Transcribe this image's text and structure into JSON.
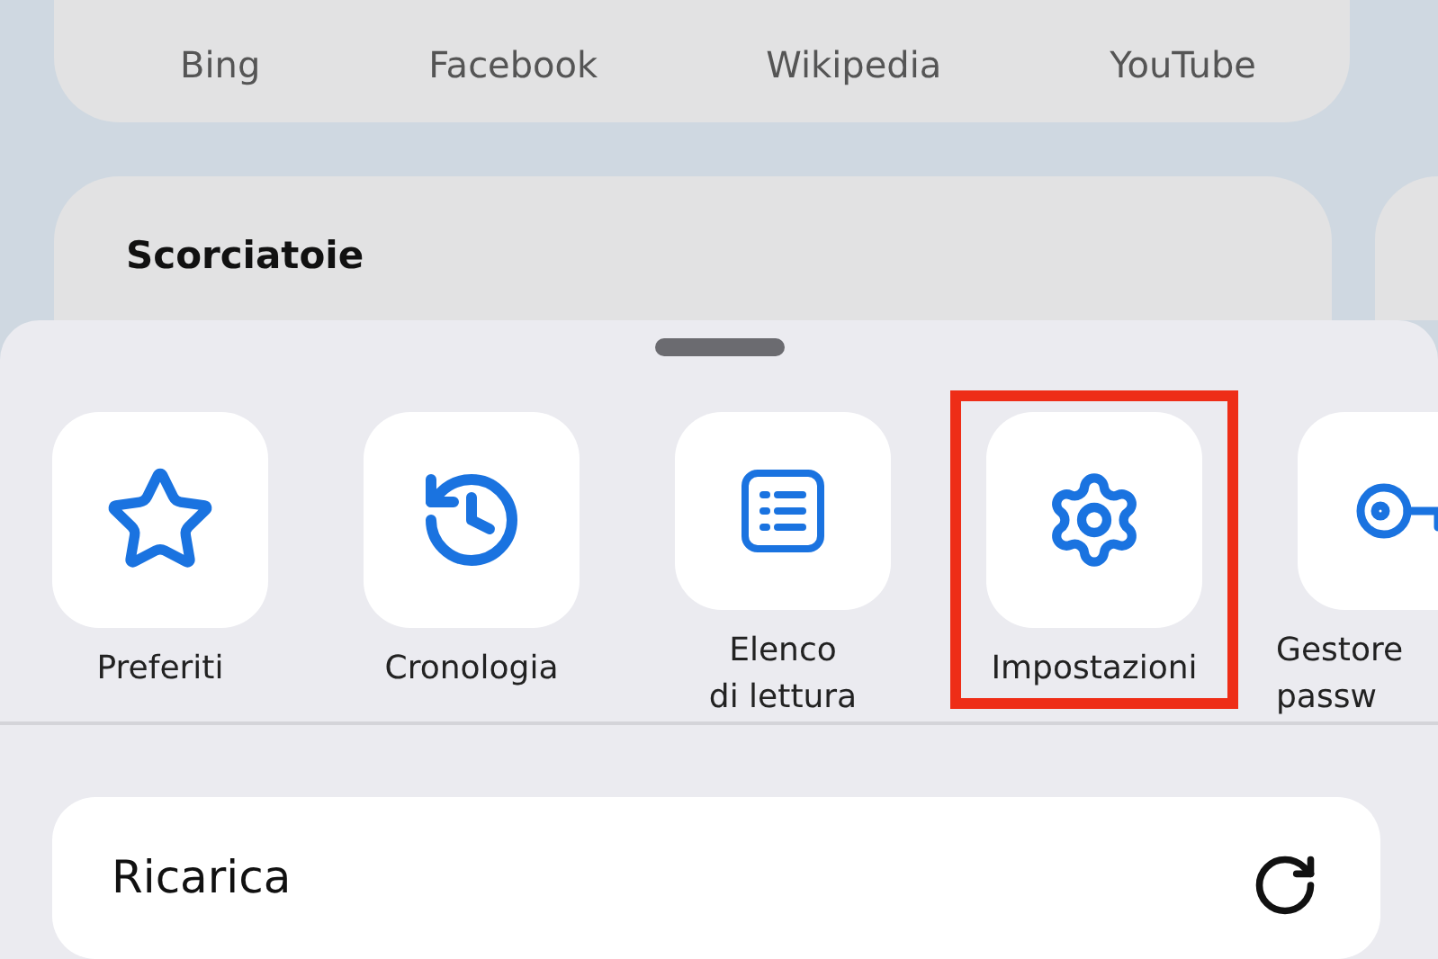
{
  "favorites": [
    {
      "label": "Bing"
    },
    {
      "label": "Facebook"
    },
    {
      "label": "Wikipedia"
    },
    {
      "label": "YouTube"
    }
  ],
  "shortcuts": {
    "title": "Scorciatoie"
  },
  "actions": [
    {
      "kind": "star",
      "label": "Preferiti",
      "highlighted": false
    },
    {
      "kind": "history",
      "label": "Cronologia",
      "highlighted": false
    },
    {
      "kind": "list",
      "label": "Elenco\ndi lettura",
      "highlighted": false
    },
    {
      "kind": "gear",
      "label": "Impostazioni",
      "highlighted": true
    },
    {
      "kind": "key",
      "label": "Gestore\npassw",
      "highlighted": false
    }
  ],
  "menu": [
    {
      "kind": "reload",
      "label": "Ricarica"
    }
  ]
}
